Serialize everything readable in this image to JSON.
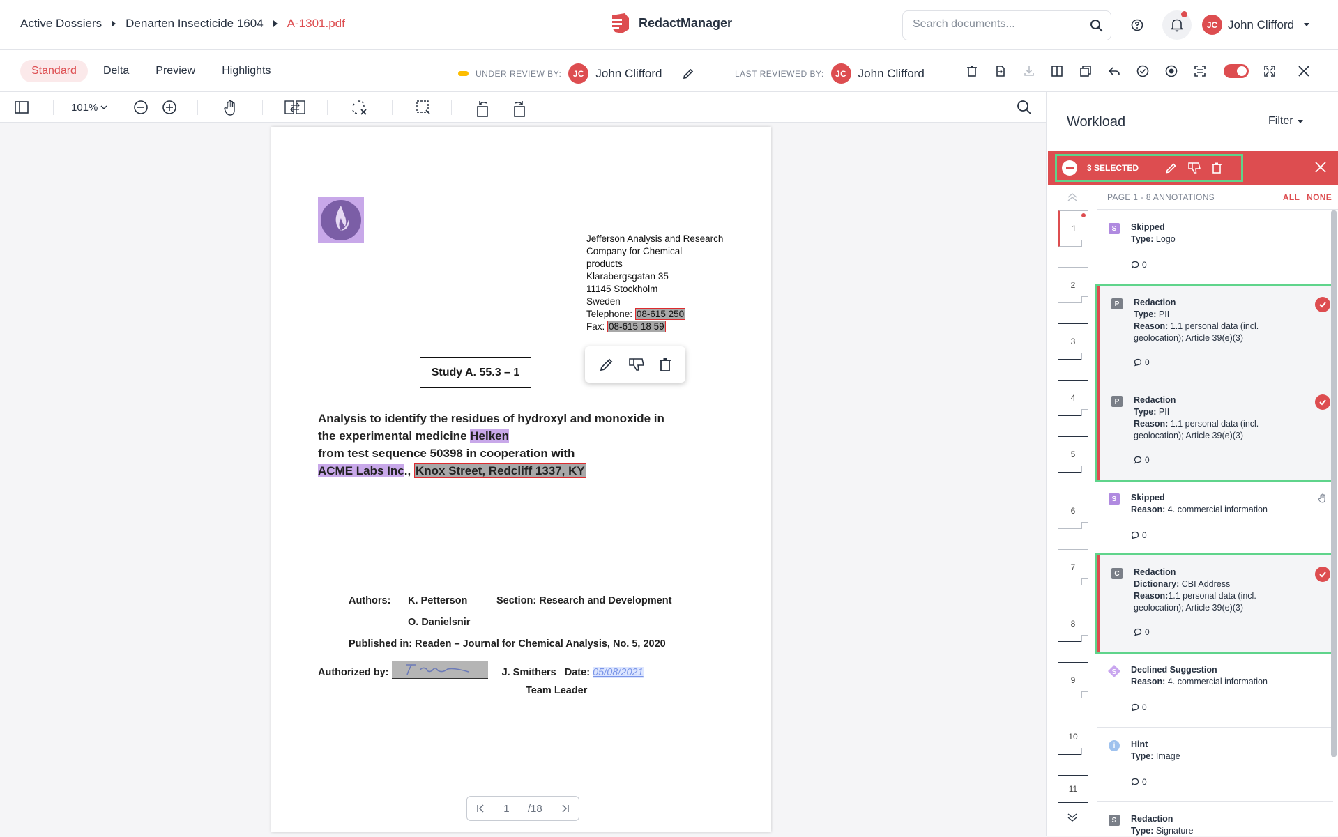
{
  "breadcrumbs": [
    "Active Dossiers",
    "Denarten Insecticide 1604",
    "A-1301.pdf"
  ],
  "app": {
    "name": "RedactManager"
  },
  "search": {
    "placeholder": "Search documents..."
  },
  "user": {
    "initials": "JC",
    "name": "John Clifford"
  },
  "tabs": [
    "Standard",
    "Delta",
    "Preview",
    "Highlights"
  ],
  "review": {
    "under_label": "UNDER REVIEW BY:",
    "under_name": "John Clifford",
    "last_label": "LAST REVIEWED BY:",
    "last_name": "John Clifford"
  },
  "viewer": {
    "zoom": "101%",
    "page_current": "1",
    "page_total": "/18"
  },
  "document": {
    "address": [
      "Jefferson Analysis and Research",
      "Company for Chemical",
      "products",
      "Klarabergsgatan 35",
      "11145 Stockholm",
      "Sweden"
    ],
    "telephone_label": "Telephone:",
    "telephone_value": "08-615 250",
    "fax_label": "Fax:",
    "fax_value": "08-615 18 59",
    "study": "Study A. 55.3 – 1",
    "heading_line1": "Analysis to identify the residues of hydroxyl and monoxide in",
    "heading_line2_pre": "the experimental medicine ",
    "heading_line2_hl": "Helken",
    "heading_line3": "from test sequence 50398 in cooperation with",
    "heading_line4_hl": "ACME Labs Inc",
    "heading_line4_sep": ".,",
    "heading_line4_red": "Knox Street, Redcliff 1337, KY",
    "authors_label": "Authors:",
    "author1": "K. Petterson",
    "author2": "O. Danielsnir",
    "section": "Section: Research and Development",
    "published": "Published in: Readen – Journal for Chemical Analysis, No. 5, 2020",
    "authorized_label": "Authorized by:",
    "authorized_name": "J. Smithers",
    "date_label": "Date:",
    "date_value": "05/08/2021",
    "role": "Team Leader"
  },
  "workload": {
    "title": "Workload",
    "filter": "Filter",
    "selected": "3 SELECTED",
    "page_header": "PAGE 1 - 8 ANNOTATIONS",
    "all": "ALL",
    "none": "NONE",
    "thumbs": [
      "1",
      "2",
      "3",
      "4",
      "5",
      "6",
      "7",
      "8",
      "9",
      "10",
      "11"
    ],
    "annotations": [
      {
        "badge": "S",
        "title": "Skipped",
        "l1k": "Type:",
        "l1v": " Logo",
        "comments": "0"
      },
      {
        "badge": "P",
        "title": "Redaction",
        "l1k": "Type:",
        "l1v": " PII",
        "l2k": "Reason:",
        "l2v": " 1.1 personal data (incl. geolocation); Article 39(e)(3)",
        "comments": "0"
      },
      {
        "badge": "P",
        "title": "Redaction",
        "l1k": "Type:",
        "l1v": " PII",
        "l2k": "Reason:",
        "l2v": " 1.1 personal data (incl. geolocation); Article 39(e)(3)",
        "comments": "0"
      },
      {
        "badge": "S",
        "title": "Skipped",
        "l1k": "Reason:",
        "l1v": " 4. commercial information",
        "comments": "0"
      },
      {
        "badge": "C",
        "title": "Redaction",
        "l1k": "Dictionary:",
        "l1v": " CBI Address",
        "l2k": "Reason:",
        "l2v": "1.1 personal data (incl. geolocation); Article 39(e)(3)",
        "comments": "0"
      },
      {
        "badge": "S",
        "title": "Declined Suggestion",
        "l1k": "Reason:",
        "l1v": " 4. commercial information",
        "comments": "0"
      },
      {
        "badge": "i",
        "title": "Hint",
        "l1k": "Type:",
        "l1v": " Image",
        "comments": "0"
      },
      {
        "badge": "S",
        "title": "Redaction",
        "l1k": "Type:",
        "l1v": " Signature"
      }
    ]
  },
  "colors": {
    "accent": "#dd4d50",
    "selection": "#5fd48b",
    "purple": "#c8a8e9"
  }
}
